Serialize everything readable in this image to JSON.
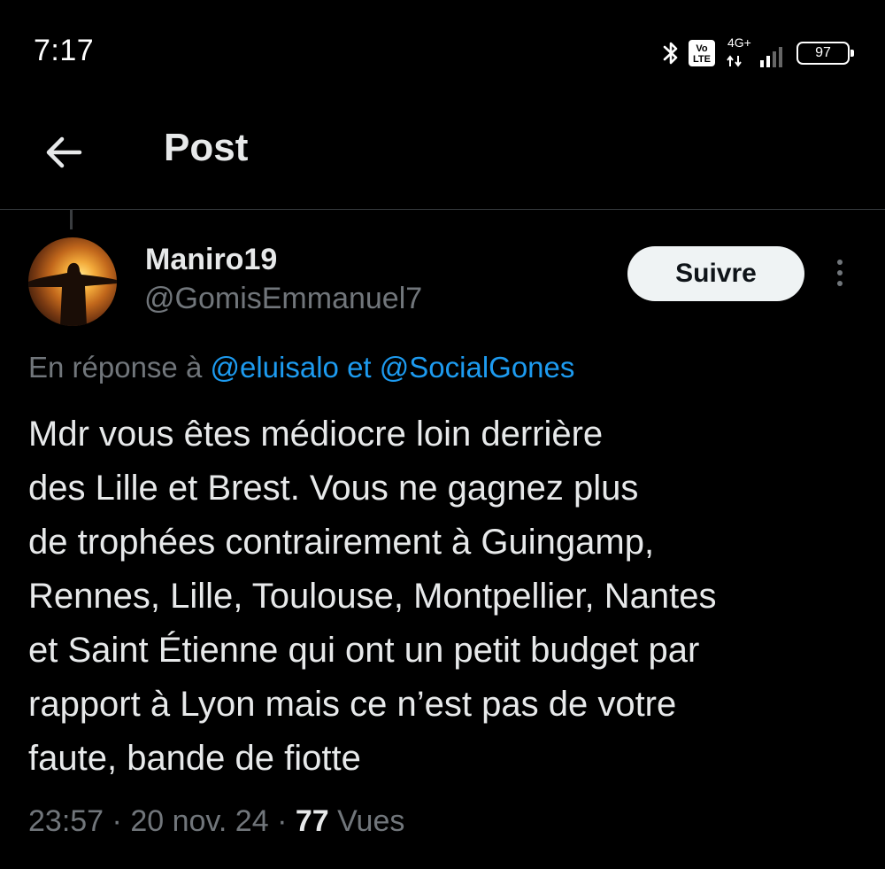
{
  "status_bar": {
    "time": "7:17",
    "volte_line1": "Vo",
    "volte_line2": "LTE",
    "network": "4G+",
    "battery": "97",
    "icons": [
      "bluetooth-icon",
      "volte-icon",
      "network-4g-icon",
      "signal-icon",
      "battery-icon"
    ]
  },
  "header": {
    "title": "Post",
    "back_icon": "arrow-left-icon"
  },
  "author": {
    "name": "Maniro19",
    "handle": "@GomisEmmanuel7",
    "follow_label": "Suivre",
    "more_icon": "more-vertical-icon"
  },
  "reply": {
    "prefix": "En réponse à",
    "mention_1": "@eluisalo",
    "joiner": "et",
    "mention_2": "@SocialGones"
  },
  "post": {
    "lines": [
      "Mdr vous êtes médiocre loin derrière",
      "des Lille et Brest. Vous ne gagnez plus",
      "de trophées contrairement à Guingamp,",
      "Rennes, Lille, Toulouse, Montpellier, Nantes",
      "et Saint Étienne qui ont un petit budget par",
      "rapport à Lyon mais ce n’est pas de votre",
      "faute, bande de fiotte"
    ]
  },
  "meta": {
    "time": "23:57",
    "separator": "·",
    "date": "20 nov. 24",
    "views_count": "77",
    "views_label": "Vues"
  },
  "colors": {
    "background": "#000000",
    "text": "#e7e9ea",
    "secondary": "#71767b",
    "link": "#1d9bf0",
    "button_bg": "#eff3f4"
  }
}
